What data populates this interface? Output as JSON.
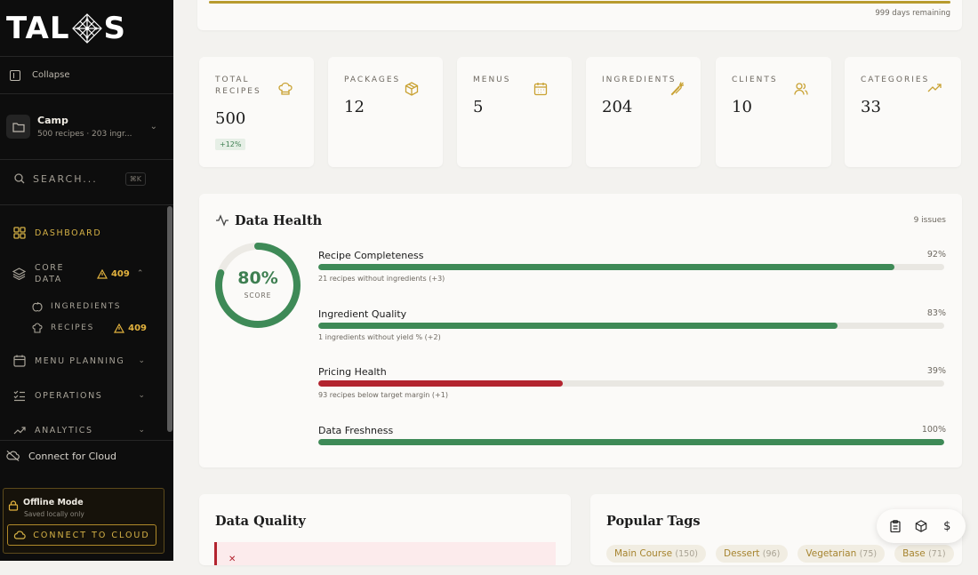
{
  "brand": {
    "logo_left": "TAL",
    "logo_right": "S"
  },
  "sidebar": {
    "collapse_label": "Collapse",
    "workspace": {
      "name": "Camp",
      "summary": "500 recipes · 203 ingr..."
    },
    "search": {
      "placeholder": "SEARCH...",
      "shortcut": "⌘K"
    },
    "nav": {
      "dashboard": "DASHBOARD",
      "core_data": "CORE\nDATA",
      "core_data_warning": "409",
      "ingredients": "INGREDIENTS",
      "recipes": "RECIPES",
      "recipes_warning": "409",
      "menu_planning": "MENU PLANNING",
      "operations": "OPERATIONS",
      "analytics": "ANALYTICS"
    },
    "connect_cloud": "Connect for Cloud",
    "offline": {
      "title": "Offline Mode",
      "subtitle": "Saved locally only",
      "button": "CONNECT TO CLOUD"
    }
  },
  "trial": {
    "days_remaining": "999 days remaining",
    "progress": 1.0
  },
  "stats": [
    {
      "label": "TOTAL\nRECIPES",
      "value": "500",
      "badge": "+12%",
      "icon": "chef-hat-icon"
    },
    {
      "label": "PACKAGES",
      "value": "12",
      "icon": "package-icon"
    },
    {
      "label": "MENUS",
      "value": "5",
      "icon": "calendar-icon"
    },
    {
      "label": "INGREDIENTS",
      "value": "204",
      "icon": "carrot-icon"
    },
    {
      "label": "CLIENTS",
      "value": "10",
      "icon": "users-icon"
    },
    {
      "label": "CATEGORIES",
      "value": "33",
      "icon": "trending-up-icon"
    }
  ],
  "data_health": {
    "title": "Data Health",
    "issues": "9 issues",
    "score": "80%",
    "score_value": 80,
    "score_label": "SCORE",
    "metrics": [
      {
        "name": "Recipe Completeness",
        "percent": "92%",
        "value": 92,
        "detail": "21 recipes without ingredients (+3)",
        "color": "#3e8a57"
      },
      {
        "name": "Ingredient Quality",
        "percent": "83%",
        "value": 83,
        "detail": "1 ingredients without yield % (+2)",
        "color": "#3e8a57"
      },
      {
        "name": "Pricing Health",
        "percent": "39%",
        "value": 39,
        "detail": "93 recipes below target margin (+1)",
        "color": "#b3242f"
      },
      {
        "name": "Data Freshness",
        "percent": "100%",
        "value": 100,
        "detail": "",
        "color": "#3e8a57"
      }
    ]
  },
  "data_quality": {
    "title": "Data Quality"
  },
  "popular_tags": {
    "title": "Popular Tags",
    "tags": [
      {
        "name": "Main Course",
        "count": "(150)"
      },
      {
        "name": "Dessert",
        "count": "(96)"
      },
      {
        "name": "Vegetarian",
        "count": "(75)"
      },
      {
        "name": "Base",
        "count": "(71)"
      }
    ]
  },
  "colors": {
    "accent": "#d5b146",
    "success": "#3e8a57",
    "danger": "#b3242f"
  }
}
